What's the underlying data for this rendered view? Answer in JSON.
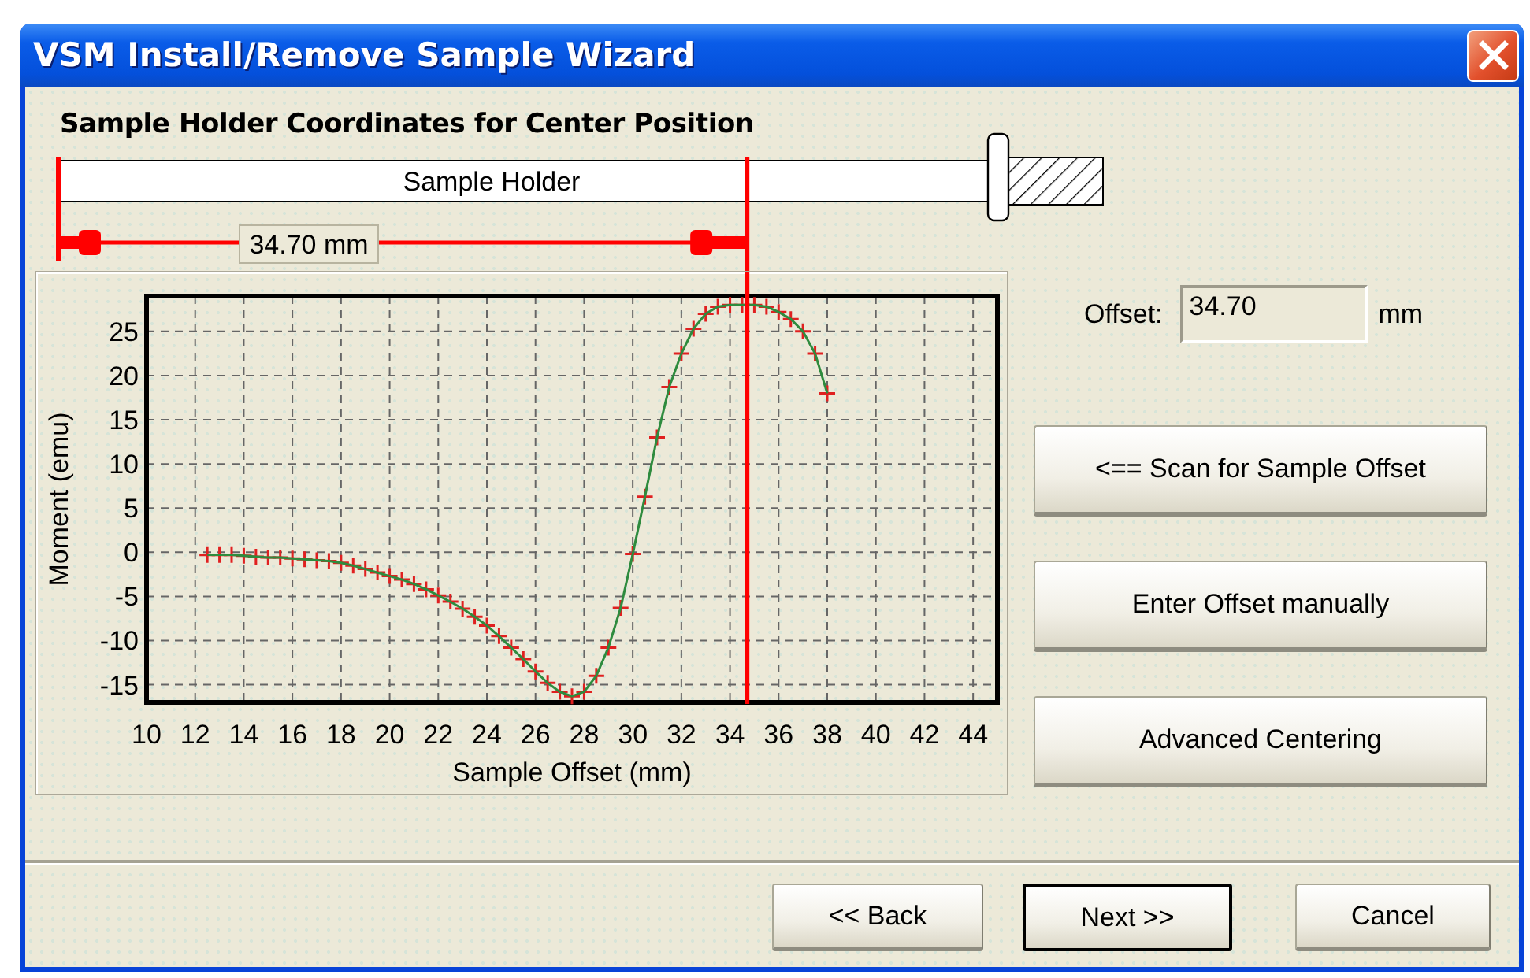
{
  "window": {
    "title": "VSM Install/Remove Sample Wizard"
  },
  "heading": "Sample Holder Coordinates for Center Position",
  "holder": {
    "label": "Sample Holder",
    "distance_label": "34.70 mm"
  },
  "chart": {
    "chart_data": {
      "type": "line",
      "xlabel": "Sample Offset (mm)",
      "ylabel": "Moment (emu)",
      "x": [
        12.5,
        13,
        13.5,
        14,
        14.5,
        15,
        15.5,
        16,
        16.5,
        17,
        17.5,
        18,
        18.5,
        19,
        19.5,
        20,
        20.5,
        21,
        21.5,
        22,
        22.5,
        23,
        23.5,
        24,
        24.5,
        25,
        25.5,
        26,
        26.5,
        27,
        27.5,
        28,
        28.5,
        29,
        29.5,
        30,
        30.5,
        31,
        31.5,
        32,
        32.5,
        33,
        33.5,
        34,
        34.5,
        35,
        35.5,
        36,
        36.5,
        37,
        37.5,
        38
      ],
      "series": [
        {
          "color": "#2e8b3e",
          "marker": "plus",
          "values": [
            -0.3,
            -0.3,
            -0.3,
            -0.4,
            -0.5,
            -0.6,
            -0.6,
            -0.7,
            -0.8,
            -0.9,
            -1.0,
            -1.2,
            -1.5,
            -1.9,
            -2.3,
            -2.7,
            -3.1,
            -3.6,
            -4.2,
            -4.9,
            -5.6,
            -6.4,
            -7.3,
            -8.3,
            -9.5,
            -10.8,
            -12.1,
            -13.5,
            -14.8,
            -15.8,
            -16.3,
            -15.8,
            -14.0,
            -10.8,
            -6.3,
            -0.2,
            6.3,
            13.0,
            18.7,
            22.5,
            25.3,
            27.0,
            27.8,
            28.0,
            28.0,
            28.0,
            27.8,
            27.2,
            26.4,
            25.0,
            22.5,
            18.0
          ]
        }
      ],
      "xlim": [
        10,
        45
      ],
      "ylim": [
        -17,
        29
      ],
      "xticks": [
        10,
        12,
        14,
        16,
        18,
        20,
        22,
        24,
        26,
        28,
        30,
        32,
        34,
        36,
        38,
        40,
        42,
        44
      ],
      "yticks": [
        -15,
        -10,
        -5,
        0,
        5,
        10,
        15,
        20,
        25
      ],
      "grid": true,
      "ref_lines": [
        {
          "axis": "x",
          "value": 34.7,
          "color": "#ff0000"
        }
      ]
    }
  },
  "offset": {
    "label": "Offset:",
    "value": "34.70",
    "unit": "mm"
  },
  "actions": [
    "<== Scan for Sample Offset",
    "Enter Offset manually",
    "Advanced Centering"
  ],
  "footer_buttons": [
    {
      "label": "<< Back",
      "default": false
    },
    {
      "label": "Next >>",
      "default": true
    },
    {
      "label": "Cancel",
      "default": false
    }
  ]
}
